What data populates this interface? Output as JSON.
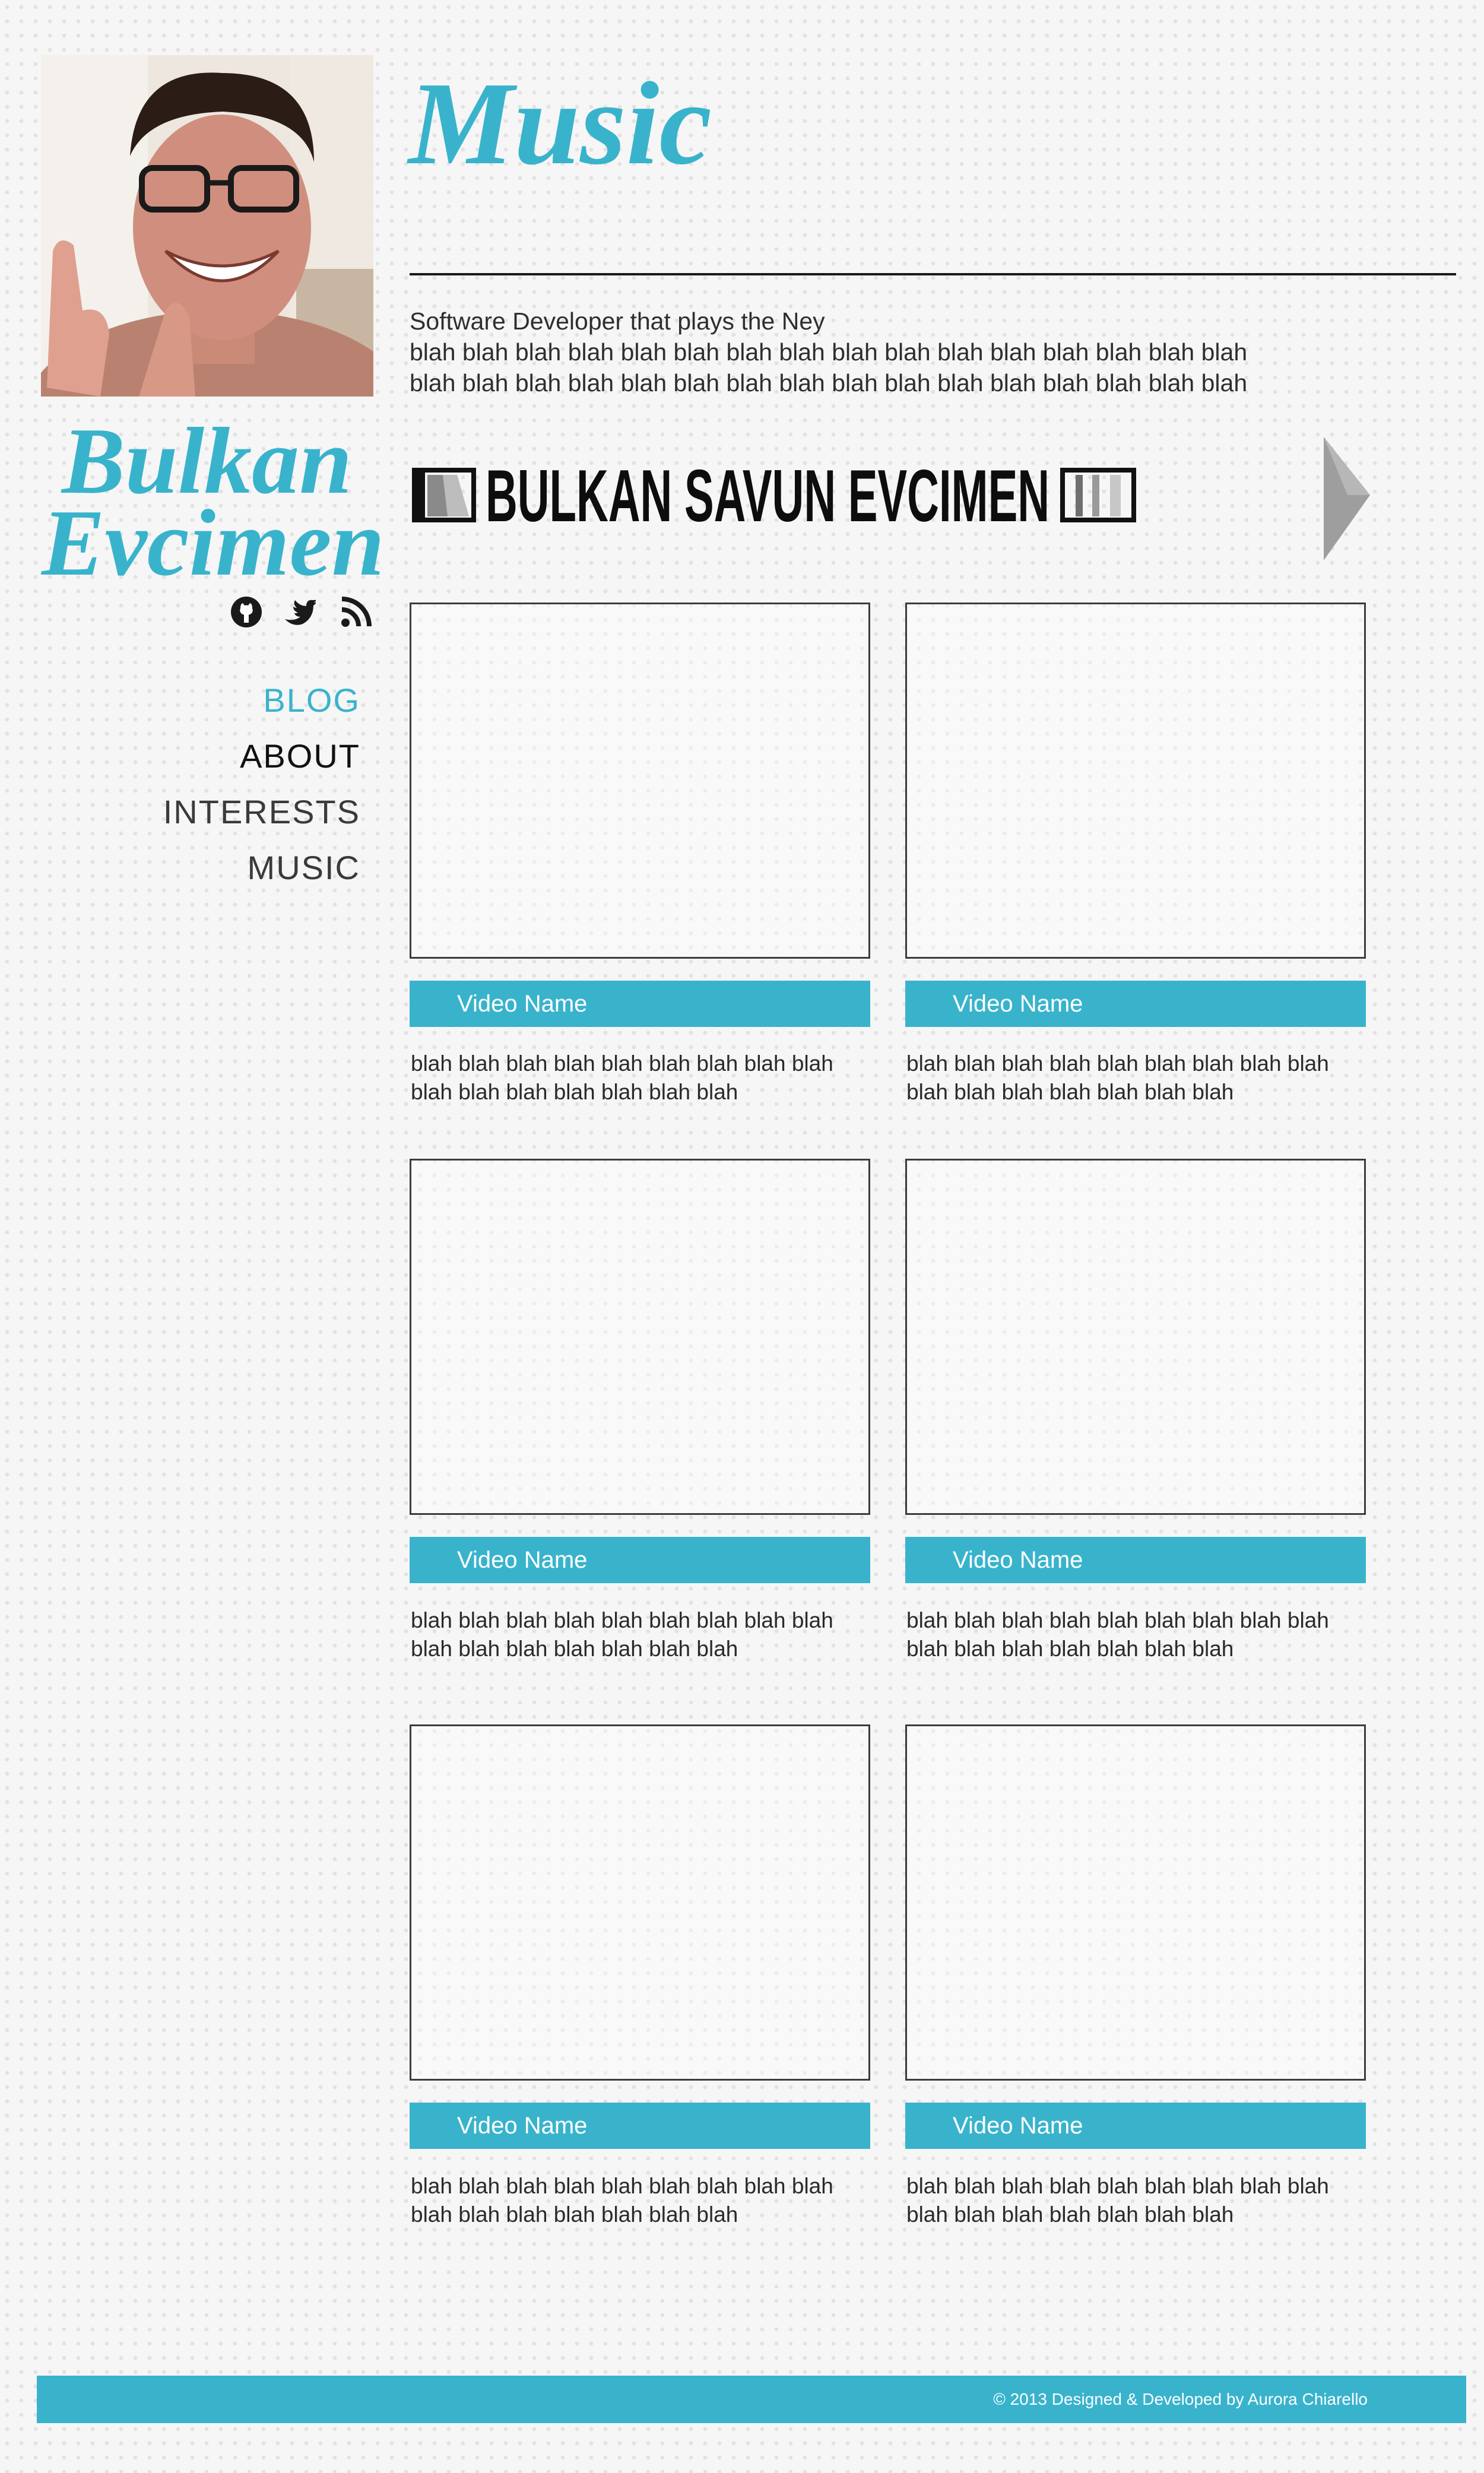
{
  "profile": {
    "photo_alt": "profile photo"
  },
  "logo": {
    "line1": "Bulkan",
    "line2": "Evcimen",
    "color": "#39b3cc"
  },
  "social": {
    "icons": [
      "github-icon",
      "twitter-icon",
      "rss-icon"
    ]
  },
  "nav": {
    "items": [
      {
        "label": "BLOG",
        "color": "#39b3cc"
      },
      {
        "label": "ABOUT",
        "color": "#111111"
      },
      {
        "label": "INTERESTS",
        "color": "#3a3a3a"
      },
      {
        "label": "MUSIC",
        "color": "#3a3a3a"
      }
    ]
  },
  "header": {
    "title": "Music"
  },
  "intro": {
    "tagline": "Software Developer that plays the Ney",
    "line1": "blah blah blah blah blah blah blah blah blah blah blah blah blah blah blah blah",
    "line2": "blah blah blah blah blah blah blah blah blah blah blah blah blah blah blah blah"
  },
  "banner": {
    "text": "BULKAN SAVUN EVCIMEN"
  },
  "videos": [
    {
      "name": "Video Name",
      "desc1": "blah blah blah blah blah blah blah blah blah",
      "desc2": "blah blah blah blah blah blah blah"
    },
    {
      "name": "Video Name",
      "desc1": "blah blah blah blah blah blah blah blah blah",
      "desc2": "blah blah blah blah blah blah blah"
    },
    {
      "name": "Video Name",
      "desc1": "blah blah blah blah blah blah blah blah blah",
      "desc2": "blah blah blah blah blah blah blah"
    },
    {
      "name": "Video Name",
      "desc1": "blah blah blah blah blah blah blah blah blah",
      "desc2": "blah blah blah blah blah blah blah"
    },
    {
      "name": "Video Name",
      "desc1": "blah blah blah blah blah blah blah blah blah",
      "desc2": "blah blah blah blah blah blah blah"
    },
    {
      "name": "Video Name",
      "desc1": "blah blah blah blah blah blah blah blah blah",
      "desc2": "blah blah blah blah blah blah blah"
    }
  ],
  "footer": {
    "text": "© 2013 Designed & Developed by Aurora Chiarello"
  },
  "colors": {
    "accent": "#39b3cc",
    "text": "#2a2a2a",
    "background": "#f6f6f6"
  }
}
